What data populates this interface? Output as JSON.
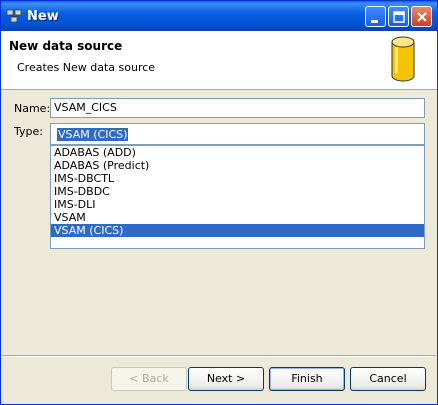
{
  "window": {
    "title": "New"
  },
  "header": {
    "title": "New data source",
    "description": "Creates New data source"
  },
  "form": {
    "name_label": "Name:",
    "name_value": "VSAM_CICS",
    "type_label": "Type:",
    "type_value": "VSAM (CICS)"
  },
  "type_list": {
    "items": [
      "ADABAS (ADD)",
      "ADABAS (Predict)",
      "IMS-DBCTL",
      "IMS-DBDC",
      "IMS-DLI",
      "VSAM",
      "VSAM (CICS)"
    ],
    "selected": "VSAM (CICS)"
  },
  "buttons": {
    "back": "< Back",
    "next": "Next >",
    "finish": "Finish",
    "cancel": "Cancel"
  },
  "icons": {
    "app": "network-icon",
    "header": "database-cylinder-icon"
  },
  "colors": {
    "titlebar": "#0a5fe0",
    "selection": "#316ac5",
    "cylinder": "#f5c400"
  }
}
